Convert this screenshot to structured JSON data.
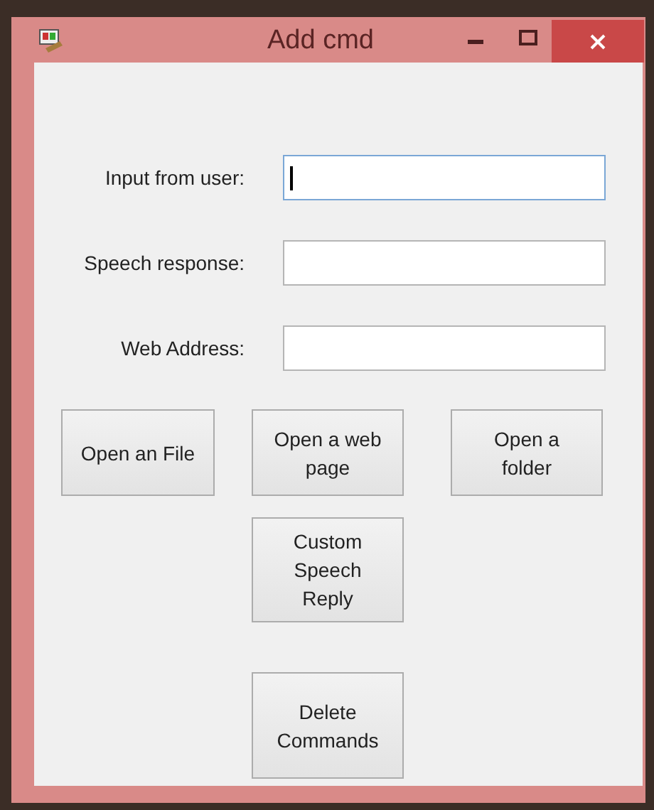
{
  "window": {
    "title": "Add cmd"
  },
  "fields": [
    {
      "label": "Input from user:",
      "focused": true
    },
    {
      "label": "Speech response:",
      "focused": false
    },
    {
      "label": "Web Address:",
      "focused": false
    }
  ],
  "button_rows": [
    [
      {
        "label": "Open an File"
      },
      {
        "label": "Open a web page"
      },
      {
        "label": "Open a folder"
      }
    ],
    [
      {
        "label": "Custom Speech Reply"
      }
    ],
    [
      {
        "label": "Delete Commands"
      }
    ]
  ]
}
